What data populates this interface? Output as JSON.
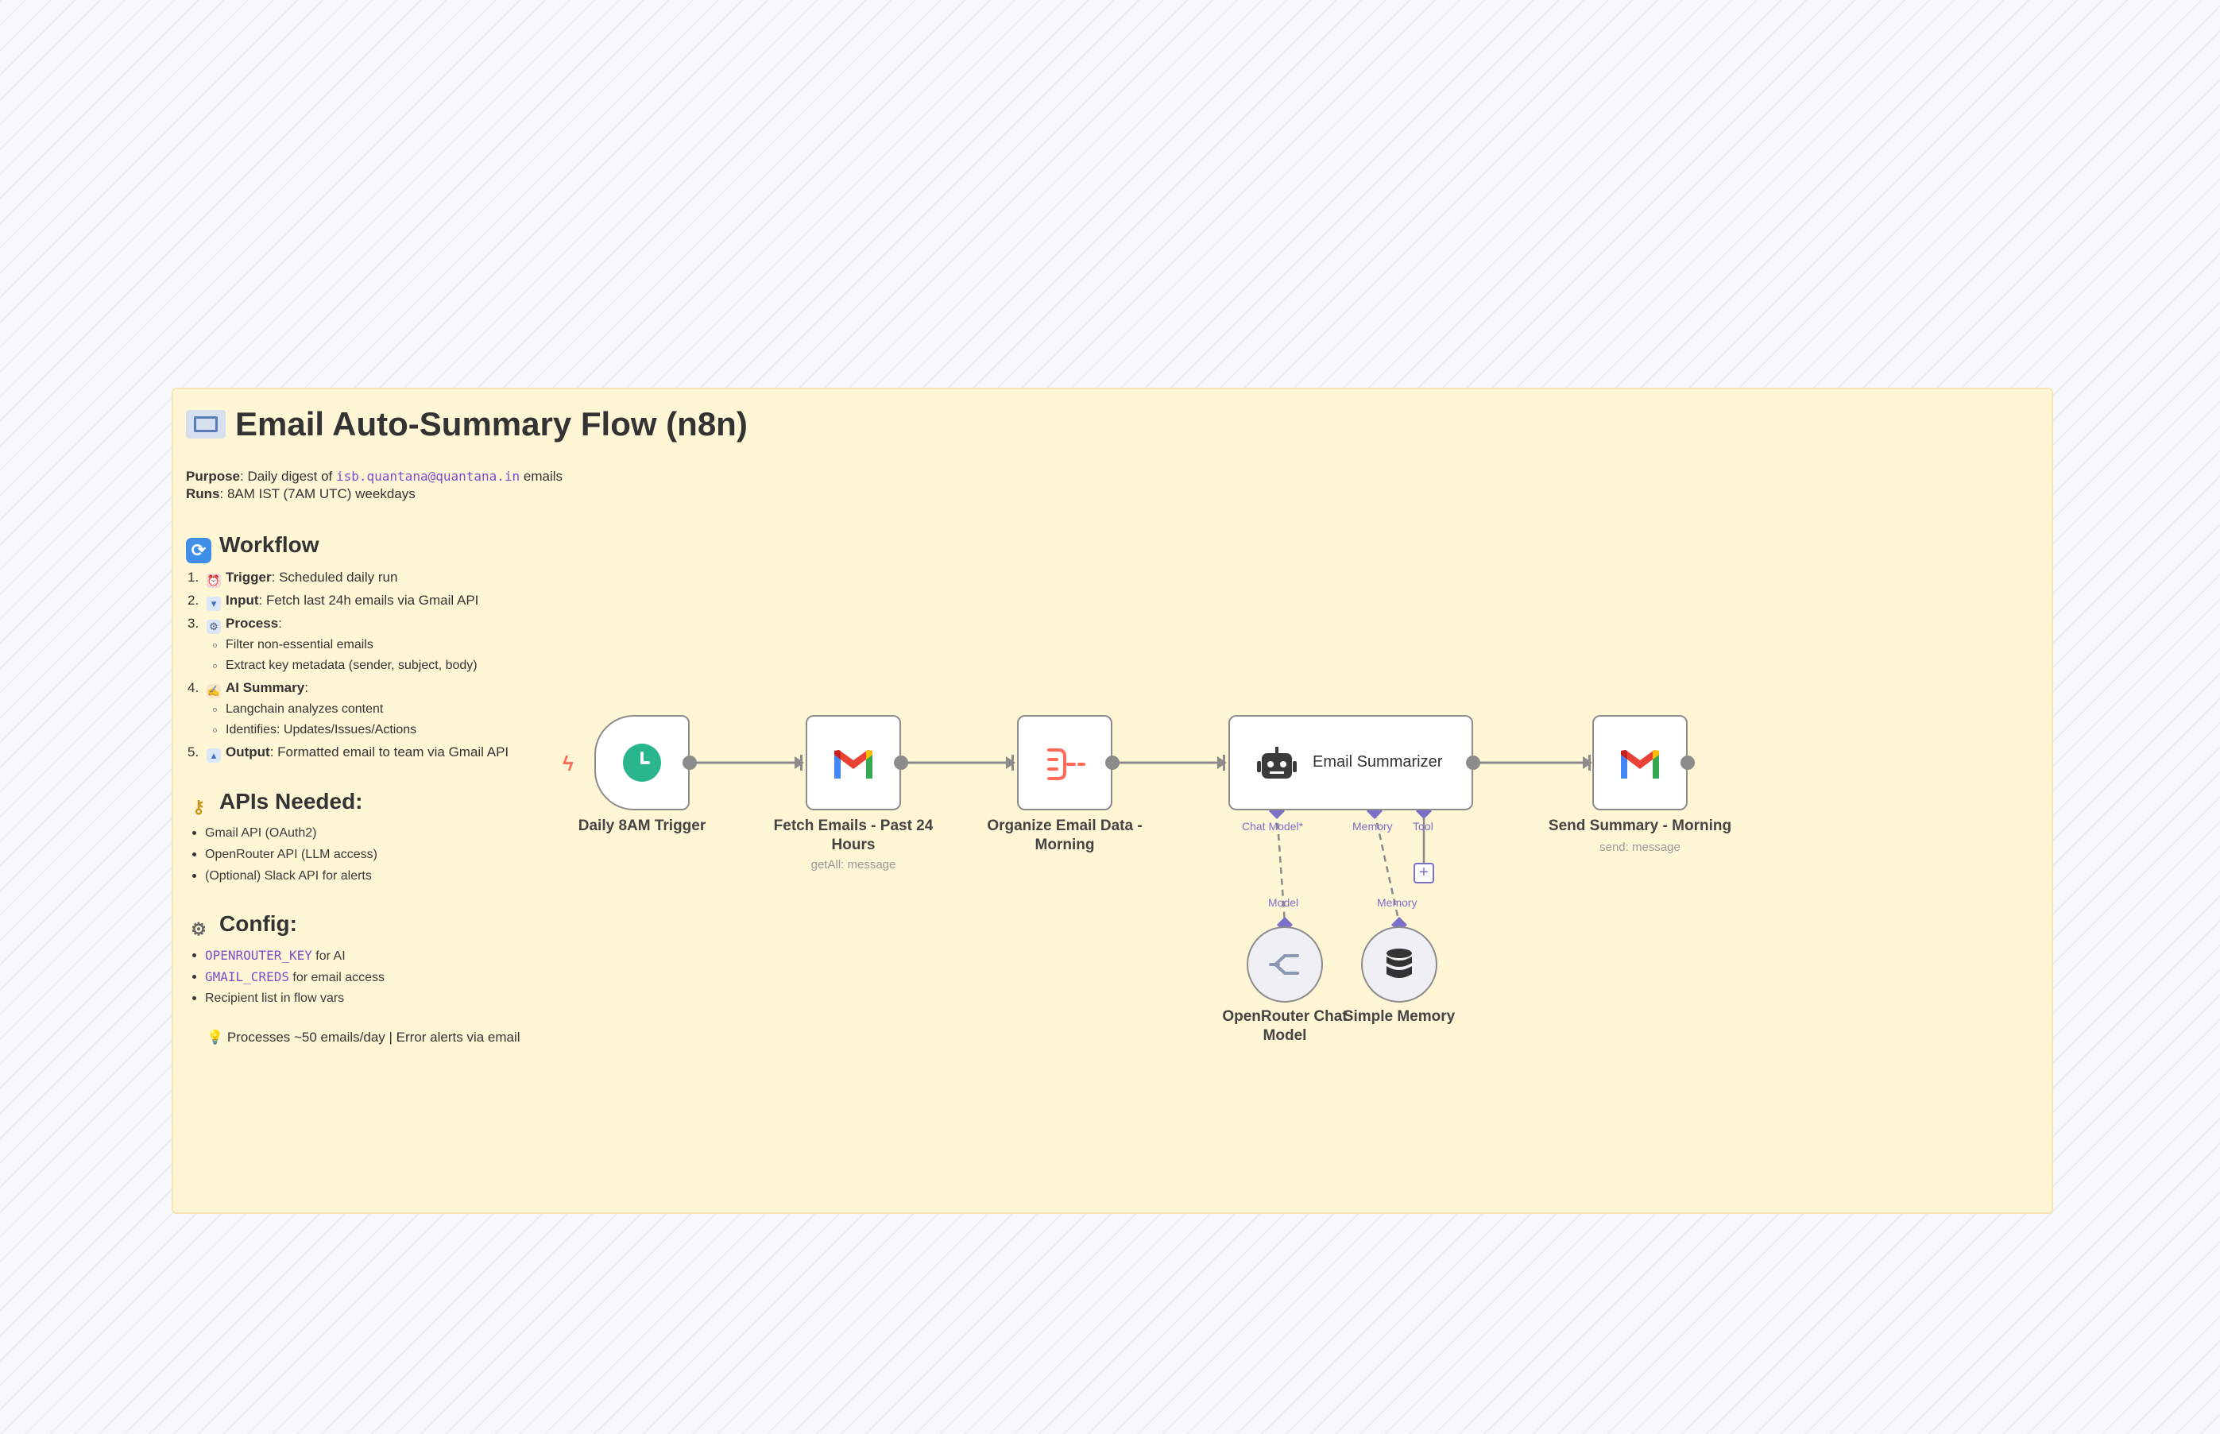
{
  "note": {
    "title": "Email Auto-Summary Flow (n8n)",
    "purpose_label": "Purpose",
    "purpose_text": ": Daily digest of ",
    "purpose_email": "isb.quantana@quantana.in",
    "purpose_tail": " emails",
    "runs_label": "Runs",
    "runs_text": ": 8AM IST (7AM UTC) weekdays",
    "workflow_heading": "Workflow",
    "workflow": [
      {
        "num": "1.",
        "bold": "Trigger",
        "text": ": Scheduled daily run"
      },
      {
        "num": "2.",
        "bold": "Input",
        "text": ": Fetch last 24h emails via Gmail API"
      },
      {
        "num": "3.",
        "bold": "Process",
        "text": ":"
      },
      {
        "sub": "Filter non-essential emails"
      },
      {
        "sub": "Extract key metadata (sender, subject, body)"
      },
      {
        "num": "4.",
        "bold": "AI Summary",
        "text": ":"
      },
      {
        "sub": "Langchain analyzes content"
      },
      {
        "sub": "Identifies: Updates/Issues/Actions"
      },
      {
        "num": "5.",
        "bold": "Output",
        "text": ": Formatted email to team via Gmail API"
      }
    ],
    "apis_heading": "APIs Needed:",
    "apis": [
      "Gmail API (OAuth2)",
      "OpenRouter API (LLM access)",
      "(Optional) Slack API for alerts"
    ],
    "config_heading": "Config:",
    "config": [
      {
        "code": "OPENROUTER_KEY",
        "text": " for AI"
      },
      {
        "code": "GMAIL_CREDS",
        "text": " for email access"
      },
      {
        "code": "",
        "text": "Recipient list in flow vars"
      }
    ],
    "tip": "Processes ~50 emails/day | Error alerts via email"
  },
  "nodes": {
    "trigger": {
      "label": "Daily 8AM Trigger"
    },
    "fetch": {
      "label": "Fetch Emails - Past 24 Hours",
      "subtitle": "getAll: message"
    },
    "organize": {
      "label": "Organize Email Data - Morning"
    },
    "summarizer": {
      "label": "Email Summarizer",
      "port_chat": "Chat Model*",
      "port_memory": "Memory",
      "port_tool": "Tool"
    },
    "send": {
      "label": "Send Summary - Morning",
      "subtitle": "send: message"
    },
    "openrouter": {
      "label": "OpenRouter Chat Model",
      "port": "Model"
    },
    "memory": {
      "label": "Simple Memory",
      "port": "Memory"
    }
  },
  "colors": {
    "sticky_bg": "#fff6d6",
    "gmail_red": "#ea4335",
    "gmail_blue": "#4285f4",
    "gmail_green": "#34a853",
    "gmail_yellow": "#fbbc04",
    "trigger_green": "#2ab68d",
    "ai_port": "#7b71c9"
  }
}
